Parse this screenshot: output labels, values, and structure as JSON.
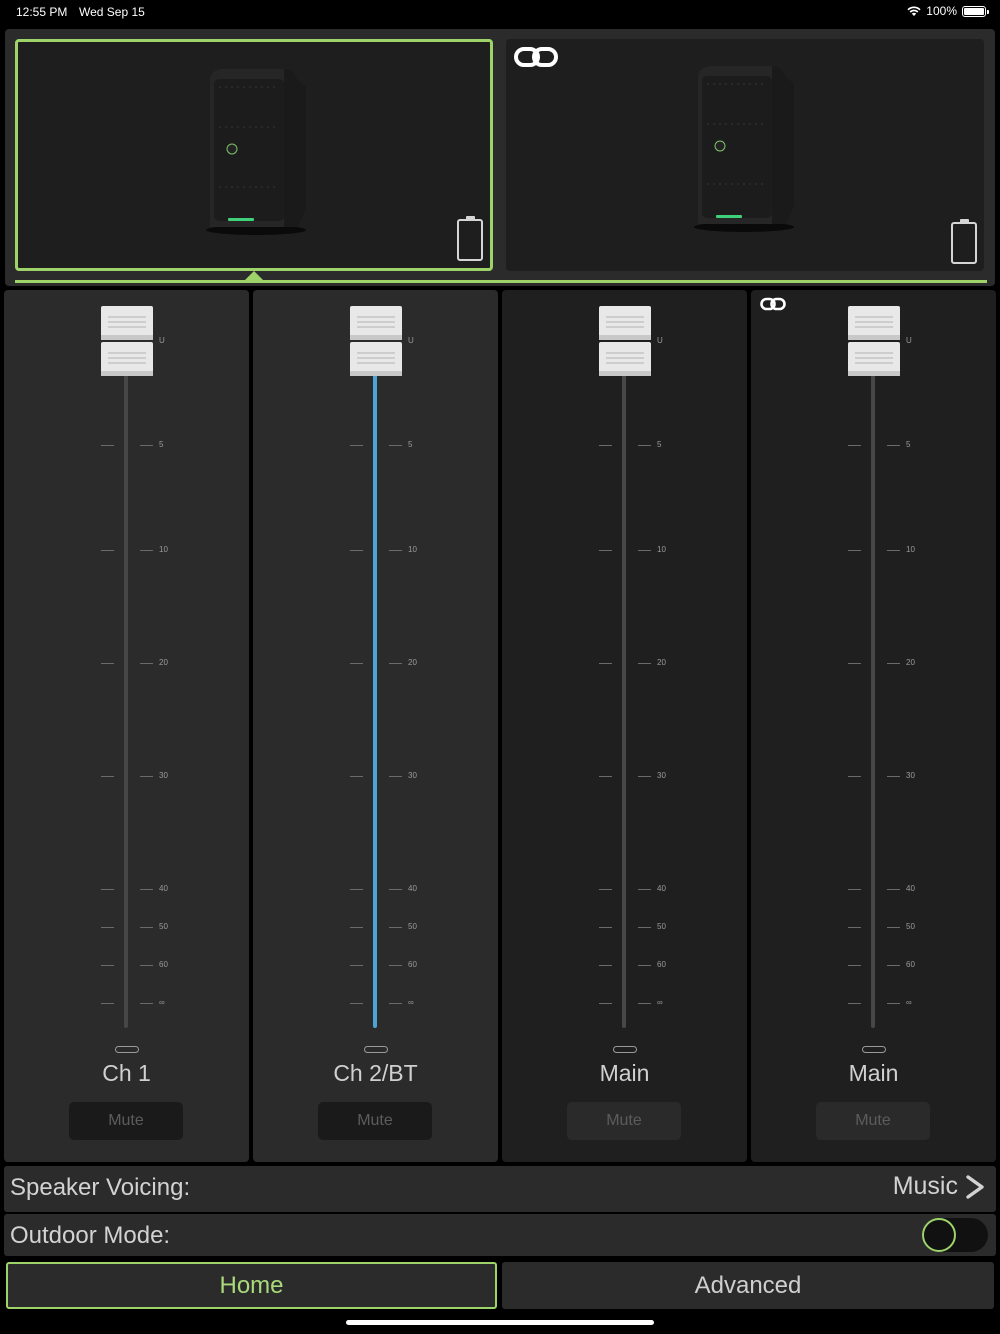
{
  "status_bar": {
    "time": "12:55 PM",
    "date": "Wed Sep 15",
    "battery_percent": "100%"
  },
  "speakers": [
    {
      "selected": true,
      "linked": false,
      "icon": "battery-icon"
    },
    {
      "selected": false,
      "linked": true,
      "icon": "link-icon"
    }
  ],
  "fader_scale": [
    "U",
    "5",
    "10",
    "20",
    "30",
    "40",
    "50",
    "60",
    "∞"
  ],
  "channels": [
    {
      "name": "Ch 1",
      "mute_label": "Mute",
      "active": false,
      "linked": false
    },
    {
      "name": "Ch 2/BT",
      "mute_label": "Mute",
      "active": true,
      "linked": false
    },
    {
      "name": "Main",
      "mute_label": "Mute",
      "active": false,
      "linked": false
    },
    {
      "name": "Main",
      "mute_label": "Mute",
      "active": false,
      "linked": true
    }
  ],
  "settings": {
    "voicing_label": "Speaker Voicing:",
    "voicing_value": "Music",
    "outdoor_label": "Outdoor Mode:",
    "outdoor_on": false
  },
  "tabs": {
    "home": "Home",
    "advanced": "Advanced",
    "selected": "home"
  },
  "colors": {
    "accent": "#9ed36a",
    "fader_active": "#4ea3d6",
    "panel": "#2b2b2b"
  }
}
